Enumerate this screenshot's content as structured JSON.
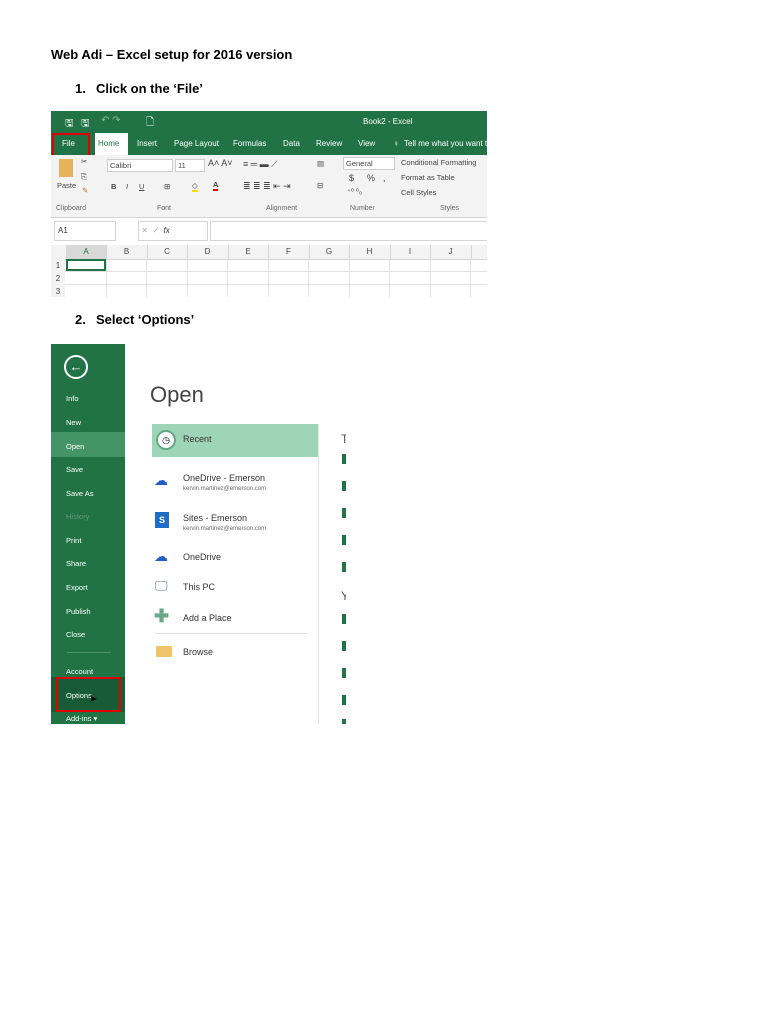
{
  "heading": "Web Adi – Excel setup for 2016 version",
  "steps": [
    {
      "number": "1.",
      "text": "Click on the ‘File’"
    },
    {
      "number": "2.",
      "text": "Select ‘Options’"
    }
  ],
  "excel": {
    "window_title": "Book2 - Excel",
    "tabs": [
      "File",
      "Home",
      "Insert",
      "Page Layout",
      "Formulas",
      "Data",
      "Review",
      "View"
    ],
    "tell_me": "Tell me what you want to",
    "font_name": "Calibri",
    "font_size": "11",
    "number_format": "General",
    "paste_label": "Paste",
    "groups": [
      "Clipboard",
      "Font",
      "Alignment",
      "Number",
      "Styles"
    ],
    "styles": [
      "Conditional Formatting",
      "Format as Table",
      "Cell Styles"
    ],
    "format_buttons": [
      "B",
      "I",
      "U"
    ],
    "number_symbols": [
      "$",
      "%",
      ","
    ],
    "name_box": "A1",
    "fx": "fx",
    "columns": [
      "A",
      "B",
      "C",
      "D",
      "E",
      "F",
      "G",
      "H",
      "I",
      "J"
    ],
    "rows": [
      "1",
      "2",
      "3"
    ]
  },
  "backstage": {
    "title": "Open",
    "menu": [
      "Info",
      "New",
      "Open",
      "Save",
      "Save As",
      "History",
      "Print",
      "Share",
      "Export",
      "Publish",
      "Close",
      "Account",
      "Options",
      "Add-ins ▾"
    ],
    "locations": [
      {
        "name": "Recent",
        "icon": "clock-icon"
      },
      {
        "name": "OneDrive - Emerson",
        "email": "kervin.martinez@emerson.com",
        "icon": "onedrive-icon"
      },
      {
        "name": "Sites - Emerson",
        "email": "kervin.martinez@emerson.com",
        "icon": "sharepoint-icon"
      },
      {
        "name": "OneDrive",
        "icon": "onedrive-icon"
      },
      {
        "name": "This PC",
        "icon": "computer-icon"
      },
      {
        "name": "Add a Place",
        "icon": "plus-icon"
      },
      {
        "name": "Browse",
        "icon": "folder-icon"
      }
    ],
    "right_letters": [
      "T",
      "Y"
    ]
  },
  "colors": {
    "excel_green": "#217346",
    "highlight": "#e00000",
    "recent_bg": "#9fd5b7"
  }
}
